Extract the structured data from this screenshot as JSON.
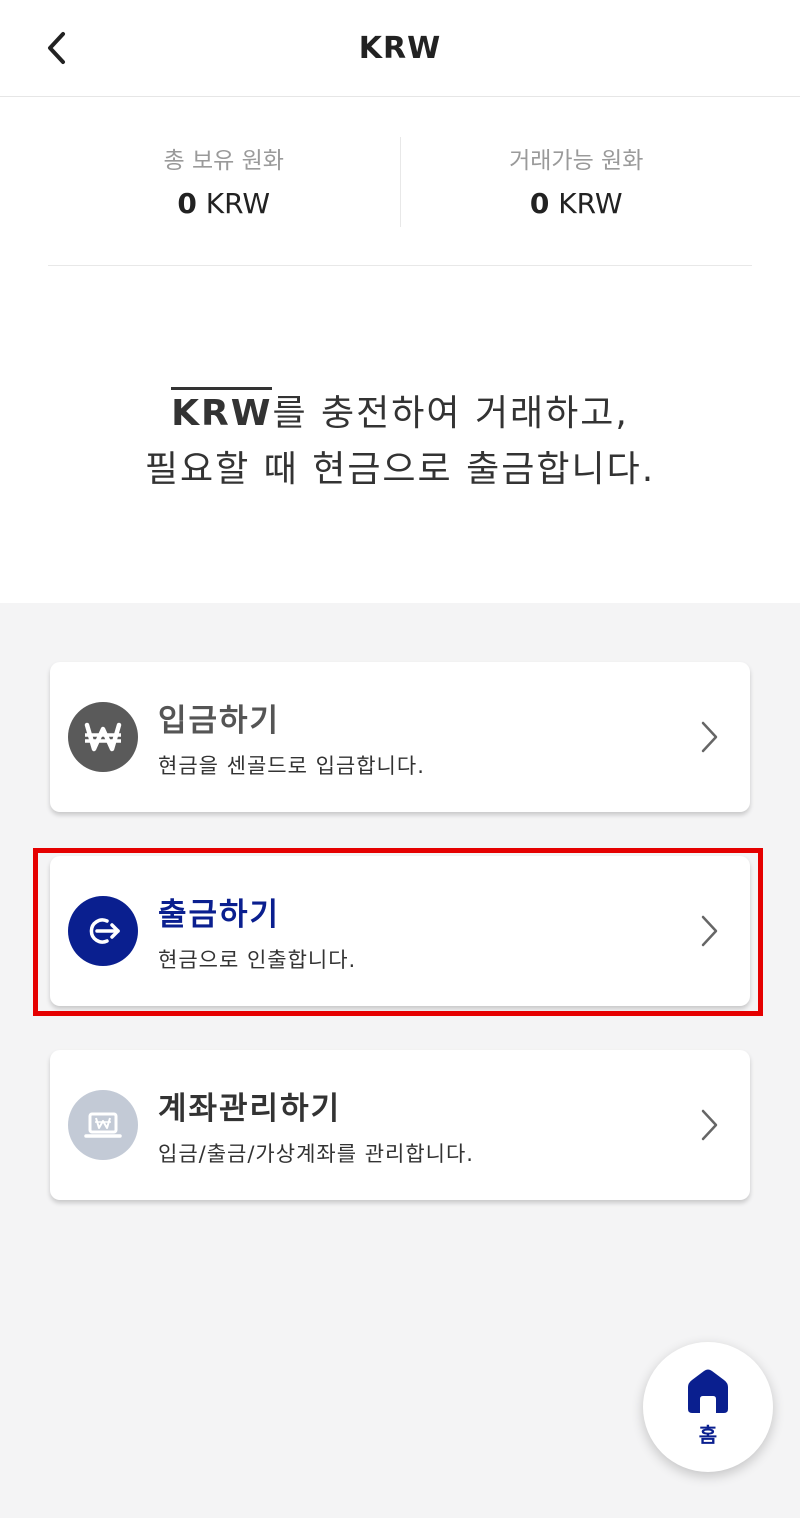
{
  "header": {
    "title": "KRW",
    "back_icon": "chevron-left-icon"
  },
  "balances": {
    "total": {
      "label": "총 보유 원화",
      "amount": "0",
      "unit": "KRW"
    },
    "tradable": {
      "label": "거래가능 원화",
      "amount": "0",
      "unit": "KRW"
    }
  },
  "intro": {
    "krw": "KRW",
    "line1_rest": "를 충전하여 거래하고,",
    "line2": "필요할 때 현금으로 출금합니다."
  },
  "cards": [
    {
      "title": "입금하기",
      "subtitle": "현금을 센골드로 입금합니다.",
      "icon": "won-icon",
      "icon_bg": "#5a5a5a",
      "title_color": "#555555"
    },
    {
      "title": "출금하기",
      "subtitle": "현금으로 인출합니다.",
      "icon": "withdraw-arrow-icon",
      "icon_bg": "#0a1f8f",
      "title_color": "#0a1f8f"
    },
    {
      "title": "계좌관리하기",
      "subtitle": "입금/출금/가상계좌를 관리합니다.",
      "icon": "laptop-won-icon",
      "icon_bg": "#c3cad6",
      "title_color": "#333333"
    }
  ],
  "home_button": {
    "label": "홈",
    "icon": "home-icon",
    "color": "#0a1f8f"
  },
  "colors": {
    "highlight": "#e50000"
  }
}
